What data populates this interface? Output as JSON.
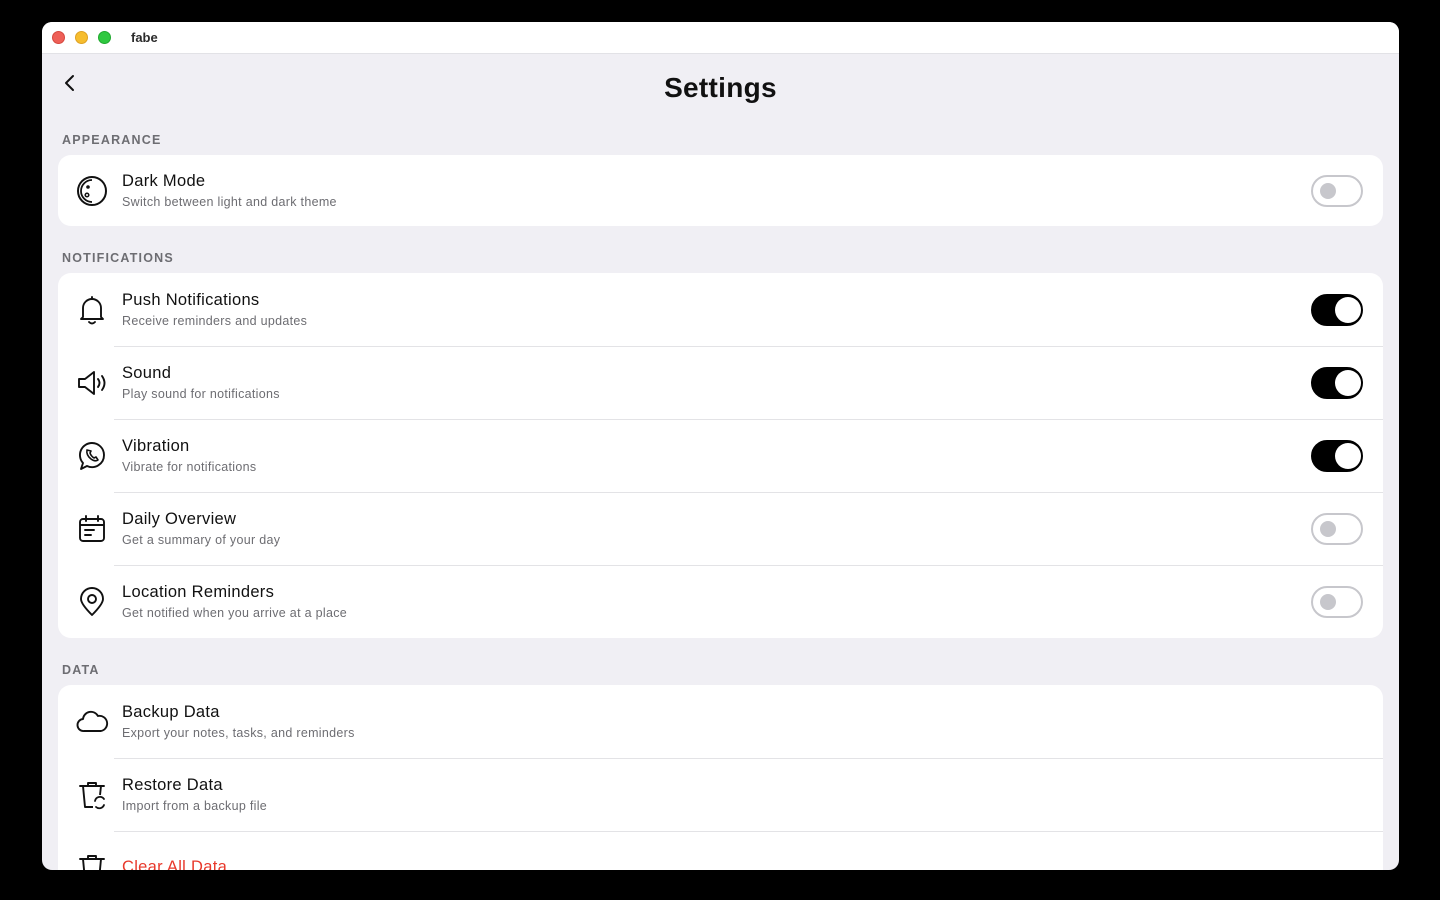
{
  "window": {
    "app_title": "fabe"
  },
  "header": {
    "title": "Settings"
  },
  "sections": {
    "appearance": {
      "label": "APPEARANCE",
      "items": [
        {
          "title": "Dark Mode",
          "subtitle": "Switch between light and dark theme",
          "icon": "moon-icon",
          "toggle": false
        }
      ]
    },
    "notifications": {
      "label": "NOTIFICATIONS",
      "items": [
        {
          "title": "Push Notifications",
          "subtitle": "Receive reminders and updates",
          "icon": "bell-icon",
          "toggle": true
        },
        {
          "title": "Sound",
          "subtitle": "Play sound for notifications",
          "icon": "speaker-icon",
          "toggle": true
        },
        {
          "title": "Vibration",
          "subtitle": "Vibrate for notifications",
          "icon": "vibration-icon",
          "toggle": true
        },
        {
          "title": "Daily Overview",
          "subtitle": "Get a summary of your day",
          "icon": "calendar-icon",
          "toggle": false
        },
        {
          "title": "Location Reminders",
          "subtitle": "Get notified when you arrive at a place",
          "icon": "location-pin-icon",
          "toggle": false
        }
      ]
    },
    "data": {
      "label": "DATA",
      "items": [
        {
          "title": "Backup Data",
          "subtitle": "Export your notes, tasks, and reminders",
          "icon": "cloud-icon"
        },
        {
          "title": "Restore Data",
          "subtitle": "Import from a backup file",
          "icon": "restore-icon"
        },
        {
          "title": "Clear All Data",
          "icon": "trash-icon",
          "color": "#e8392c"
        }
      ]
    }
  }
}
